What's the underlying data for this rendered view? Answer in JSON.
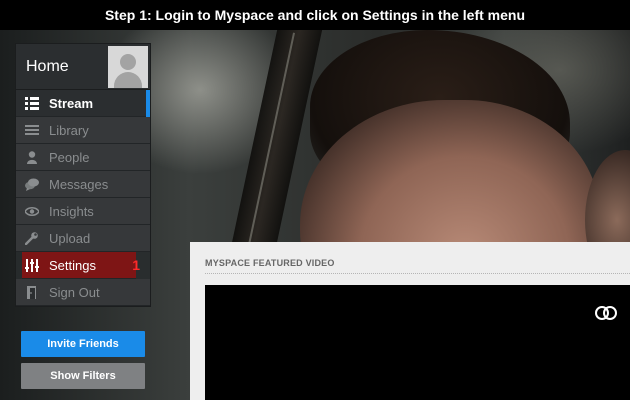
{
  "caption": "Step 1: Login to Myspace and click on Settings in the left menu",
  "sidebar": {
    "home_label": "Home",
    "items": [
      {
        "label": "Stream",
        "icon": "stream-icon",
        "state": "active"
      },
      {
        "label": "Library",
        "icon": "library-icon"
      },
      {
        "label": "People",
        "icon": "person-icon"
      },
      {
        "label": "Messages",
        "icon": "chat-bubbles-icon"
      },
      {
        "label": "Insights",
        "icon": "eye-icon"
      },
      {
        "label": "Upload",
        "icon": "wrench-icon"
      },
      {
        "label": "Settings",
        "icon": "sliders-icon",
        "state": "highlighted",
        "step_marker": "1"
      },
      {
        "label": "Sign Out",
        "icon": "door-exit-icon"
      }
    ]
  },
  "buttons": {
    "invite": "Invite Friends",
    "filters": "Show Filters"
  },
  "featured": {
    "title": "MYSPACE FEATURED VIDEO",
    "icon": "linked-rings-icon"
  },
  "colors": {
    "accent_blue": "#1a8be8",
    "highlight_red": "#7e1515",
    "step_marker_red": "#ff2a2a"
  }
}
